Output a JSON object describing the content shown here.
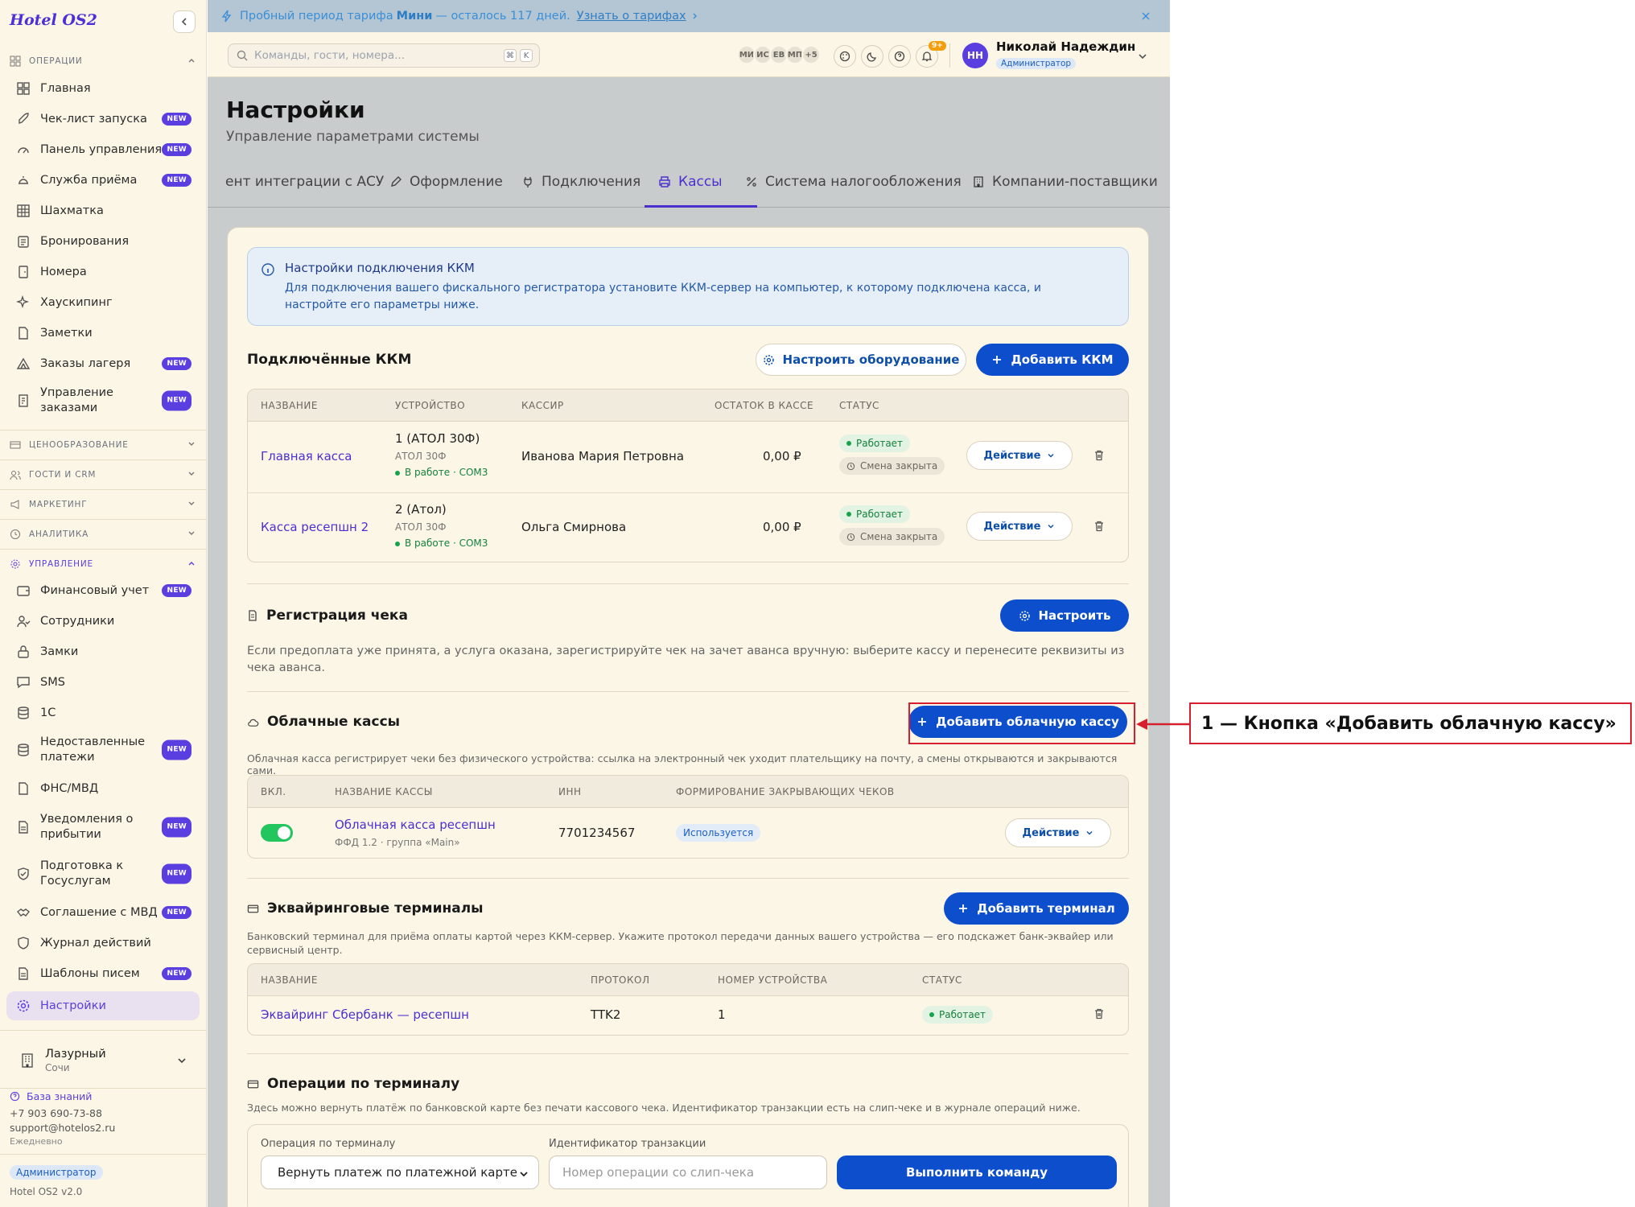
{
  "app": {
    "logo": "Hotel OS2"
  },
  "sidebar": {
    "sections": {
      "operations": "Операции",
      "pricing": "Ценообразование",
      "guests": "Гости и CRM",
      "marketing": "Маркетинг",
      "analytics": "Аналитика",
      "management": "Управление"
    },
    "new_badge": "NEW",
    "items": {
      "home": "Главная",
      "launch_checklist": "Чек-лист запуска",
      "dashboard": "Панель управления",
      "front_desk": "Служба приёма",
      "chessboard": "Шахматка",
      "bookings": "Бронирования",
      "rooms": "Номера",
      "housekeeping": "Хаускипинг",
      "notes": "Заметки",
      "camp_orders": "Заказы лагеря",
      "order_management": "Управление заказами",
      "finance": "Финансовый учет",
      "staff": "Сотрудники",
      "locks": "Замки",
      "sms": "SMS",
      "onec": "1С",
      "unpaid": "Недоставленные платежи",
      "fns": "ФНС/МВД",
      "arrival_notices": "Уведомления о прибытии",
      "gosuslugi": "Подготовка к Госуслугам",
      "mvd_agreement": "Соглашение с МВД",
      "action_log": "Журнал действий",
      "email_templates": "Шаблоны писем",
      "settings": "Настройки"
    },
    "property": {
      "name": "Лазурный",
      "city": "Сочи"
    },
    "footer": {
      "knowledge_base": "База знаний",
      "phone": "+7 903 690-73-88",
      "email": "support@hotelos2.ru",
      "hours": "Ежедневно",
      "role_badge": "Администратор",
      "version": "Hotel OS2 v2.0"
    }
  },
  "promo": {
    "prefix": "Пробный период тарифа",
    "plan": "Мини",
    "suffix": "— осталось 117 дней.",
    "link": "Узнать о тарифах"
  },
  "topbar": {
    "search_placeholder": "Команды, гости, номера...",
    "kbd1": "⌘",
    "kbd2": "K",
    "avatars": [
      "МИ",
      "ИС",
      "ЕВ",
      "МП"
    ],
    "avatars_more": "+5",
    "notif_count": "9+",
    "user_initials": "НН",
    "user_name": "Николай Надеждин",
    "user_role": "Администратор"
  },
  "page": {
    "title": "Настройки",
    "subtitle": "Управление параметрами системы"
  },
  "tabs": [
    {
      "label": "ент интеграции с АСУ"
    },
    {
      "label": "Оформление"
    },
    {
      "label": "Подключения"
    },
    {
      "label": "Кассы"
    },
    {
      "label": "Система налогообложения"
    },
    {
      "label": "Компании-поставщики"
    }
  ],
  "info": {
    "title": "Настройки подключения ККМ",
    "text": "Для подключения вашего фискального регистратора установите ККМ-сервер на компьютер, к которому подключена касса, и настройте его параметры ниже."
  },
  "kkm": {
    "title": "Подключённые ККМ",
    "configure_btn": "Настроить оборудование",
    "add_btn": "Добавить ККМ",
    "headers": [
      "Название",
      "Устройство",
      "Кассир",
      "Остаток в кассе",
      "Статус"
    ],
    "rows": [
      {
        "name": "Главная касса",
        "device": "1 (АТОЛ 30Ф)",
        "model": "АТОЛ 30Ф",
        "state": "В работе · COM3",
        "cashier": "Иванова Мария Петровна",
        "balance": "0,00 ₽",
        "status": "Работает",
        "shift": "Смена закрыта",
        "action": "Действие"
      },
      {
        "name": "Касса ресепшн 2",
        "device": "2 (Атол)",
        "model": "АТОЛ 30Ф",
        "state": "В работе · COM3",
        "cashier": "Ольга Смирнова",
        "balance": "0,00 ₽",
        "status": "Работает",
        "shift": "Смена закрыта",
        "action": "Действие"
      }
    ]
  },
  "receipt": {
    "title": "Регистрация чека",
    "btn": "Настроить",
    "text": "Если предоплата уже принята, а услуга оказана, зарегистрируйте чек на зачет аванса вручную: выберите кассу и перенесите реквизиты из чека аванса."
  },
  "cloud": {
    "title": "Облачные кассы",
    "add_btn": "Добавить облачную кассу",
    "text": "Облачная касса регистрирует чеки без физического устройства: ссылка на электронный чек уходит плательщику на почту, а смены открываются и закрываются сами.",
    "headers": [
      "Вкл.",
      "Название кассы",
      "ИНН",
      "Формирование закрывающих чеков"
    ],
    "row": {
      "name": "Облачная касса ресепшн",
      "meta": "ФФД 1.2 · группа «Main»",
      "inn": "7701234567",
      "closing": "Используется",
      "action": "Действие",
      "enabled": true
    }
  },
  "acquiring": {
    "title": "Эквайринговые терминалы",
    "add_btn": "Добавить терминал",
    "text": "Банковский терминал для приёма оплаты картой через ККМ-сервер. Укажите протокол передачи данных вашего устройства — его подскажет банк-эквайер или сервисный центр.",
    "headers": [
      "Название",
      "Протокол",
      "Номер устройства",
      "Статус"
    ],
    "row": {
      "name": "Эквайринг Сбербанк — ресепшн",
      "protocol": "TTK2",
      "device_no": "1",
      "status": "Работает"
    }
  },
  "terminal_ops": {
    "title": "Операции по терминалу",
    "text": "Здесь можно вернуть платёж по банковской карте без печати кассового чека. Идентификатор транзакции есть на слип-чеке и в журнале операций ниже.",
    "op_label": "Операция по терминалу",
    "op_value": "Вернуть платеж по платежной карте",
    "tx_label": "Идентификатор транзакции",
    "tx_placeholder": "Номер операции со слип-чека",
    "run_btn": "Выполнить команду"
  },
  "annotation": {
    "label": "1 — Кнопка «Добавить облачную кассу»"
  },
  "colors": {
    "accent": "#5b3ee0",
    "primary_button": "#0c4ecc",
    "highlight": "#d6202f",
    "success": "#16a34a"
  }
}
